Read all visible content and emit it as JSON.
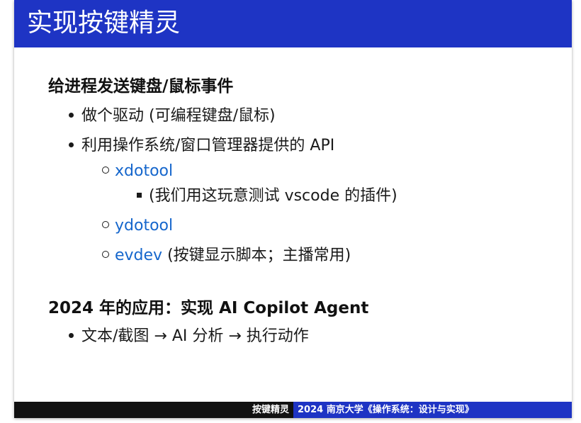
{
  "slide": {
    "title": "实现按键精灵"
  },
  "section1": {
    "heading": "给进程发送键盘/鼠标事件",
    "bullets": [
      {
        "text": "做个驱动 (可编程键盘/鼠标)"
      },
      {
        "text": "利用操作系统/窗口管理器提供的 API"
      }
    ],
    "sub_items": [
      {
        "link": "xdotool",
        "text": ""
      },
      {
        "link": "ydotool",
        "text": ""
      },
      {
        "link": "evdev",
        "text": " (按键显示脚本；主播常用)"
      }
    ],
    "sub_sub_items": [
      {
        "text": "(我们用这玩意测试 vscode 的插件)"
      }
    ]
  },
  "section2": {
    "heading": "2024 年的应用：实现 AI Copilot Agent",
    "bullets": [
      {
        "text": "文本/截图 → AI 分析 → 执行动作"
      }
    ]
  },
  "footer": {
    "left": "按键精灵",
    "right": "2024 南京大学《操作系统：设计与实现》"
  },
  "colors": {
    "title_bar": "#1e34c4",
    "link": "#1566cc",
    "footer_left": "#111111",
    "footer_right": "#1e34c4"
  }
}
